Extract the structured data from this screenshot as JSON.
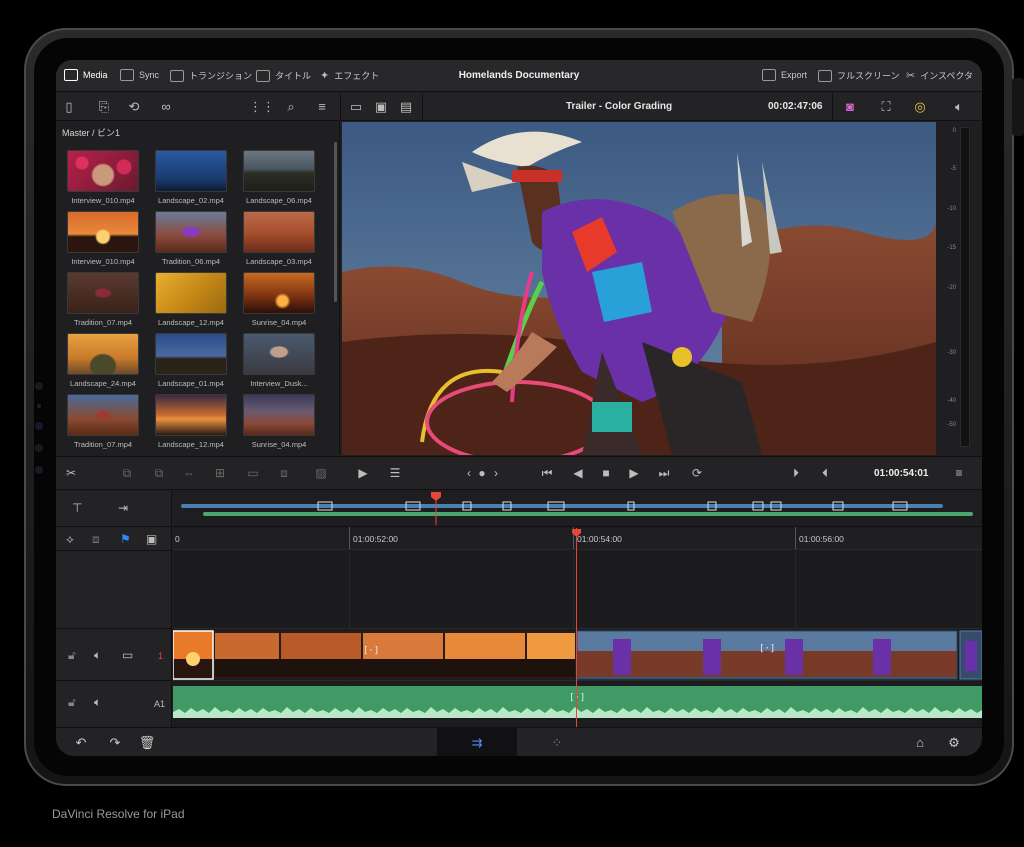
{
  "app": {
    "project_title": "Homelands Documentary",
    "caption": "DaVinci Resolve for iPad"
  },
  "topbar": {
    "left": [
      {
        "label": "Media",
        "icon": "media-icon",
        "active": true
      },
      {
        "label": "Sync",
        "icon": "sync-icon",
        "active": false
      },
      {
        "label": "トランジション",
        "icon": "transition-icon",
        "active": false
      },
      {
        "label": "タイトル",
        "icon": "title-icon",
        "active": false
      },
      {
        "label": "エフェクト",
        "icon": "effects-icon",
        "active": false
      }
    ],
    "right": [
      {
        "label": "Export",
        "icon": "export-icon"
      },
      {
        "label": "フルスクリーン",
        "icon": "fullscreen-icon"
      },
      {
        "label": "インスペクタ",
        "icon": "inspector-icon"
      }
    ]
  },
  "toolbar": {
    "timeline_name": "Trailer - Color Grading",
    "timecode": "00:02:47:06"
  },
  "media_pool": {
    "breadcrumb": "Master / ビン1",
    "clips": [
      {
        "name": "Interview_010.mp4"
      },
      {
        "name": "Landscape_02.mp4"
      },
      {
        "name": "Landscape_06.mp4"
      },
      {
        "name": "Interview_010.mp4"
      },
      {
        "name": "Tradition_06.mp4"
      },
      {
        "name": "Landscape_03.mp4"
      },
      {
        "name": "Tradition_07.mp4"
      },
      {
        "name": "Landscape_12.mp4"
      },
      {
        "name": "Sunrise_04.mp4"
      },
      {
        "name": "Landscape_24.mp4"
      },
      {
        "name": "Landscape_01.mp4"
      },
      {
        "name": "Interview_Dusk..."
      },
      {
        "name": "Tradition_07.mp4"
      },
      {
        "name": "Landscape_12.mp4"
      },
      {
        "name": "Sunrise_04.mp4"
      }
    ]
  },
  "audio_meter": {
    "ticks": [
      "0",
      "-5",
      "-10",
      "-15",
      "-20",
      "-30",
      "-40",
      "-50"
    ]
  },
  "transport": {
    "timecode": "01:00:54:01"
  },
  "timeline": {
    "ruler_labels": [
      "0",
      "01:00:52:00",
      "01:00:54:00",
      "01:00:56:00"
    ],
    "video_track_number": "1",
    "audio_track_label": "A1"
  },
  "colors": {
    "playhead": "#e6453a",
    "video_clip": "#3b5a7a",
    "audio_clip": "#3f9a66",
    "overview_video": "#4a7fb3",
    "overview_audio": "#48a86e"
  }
}
